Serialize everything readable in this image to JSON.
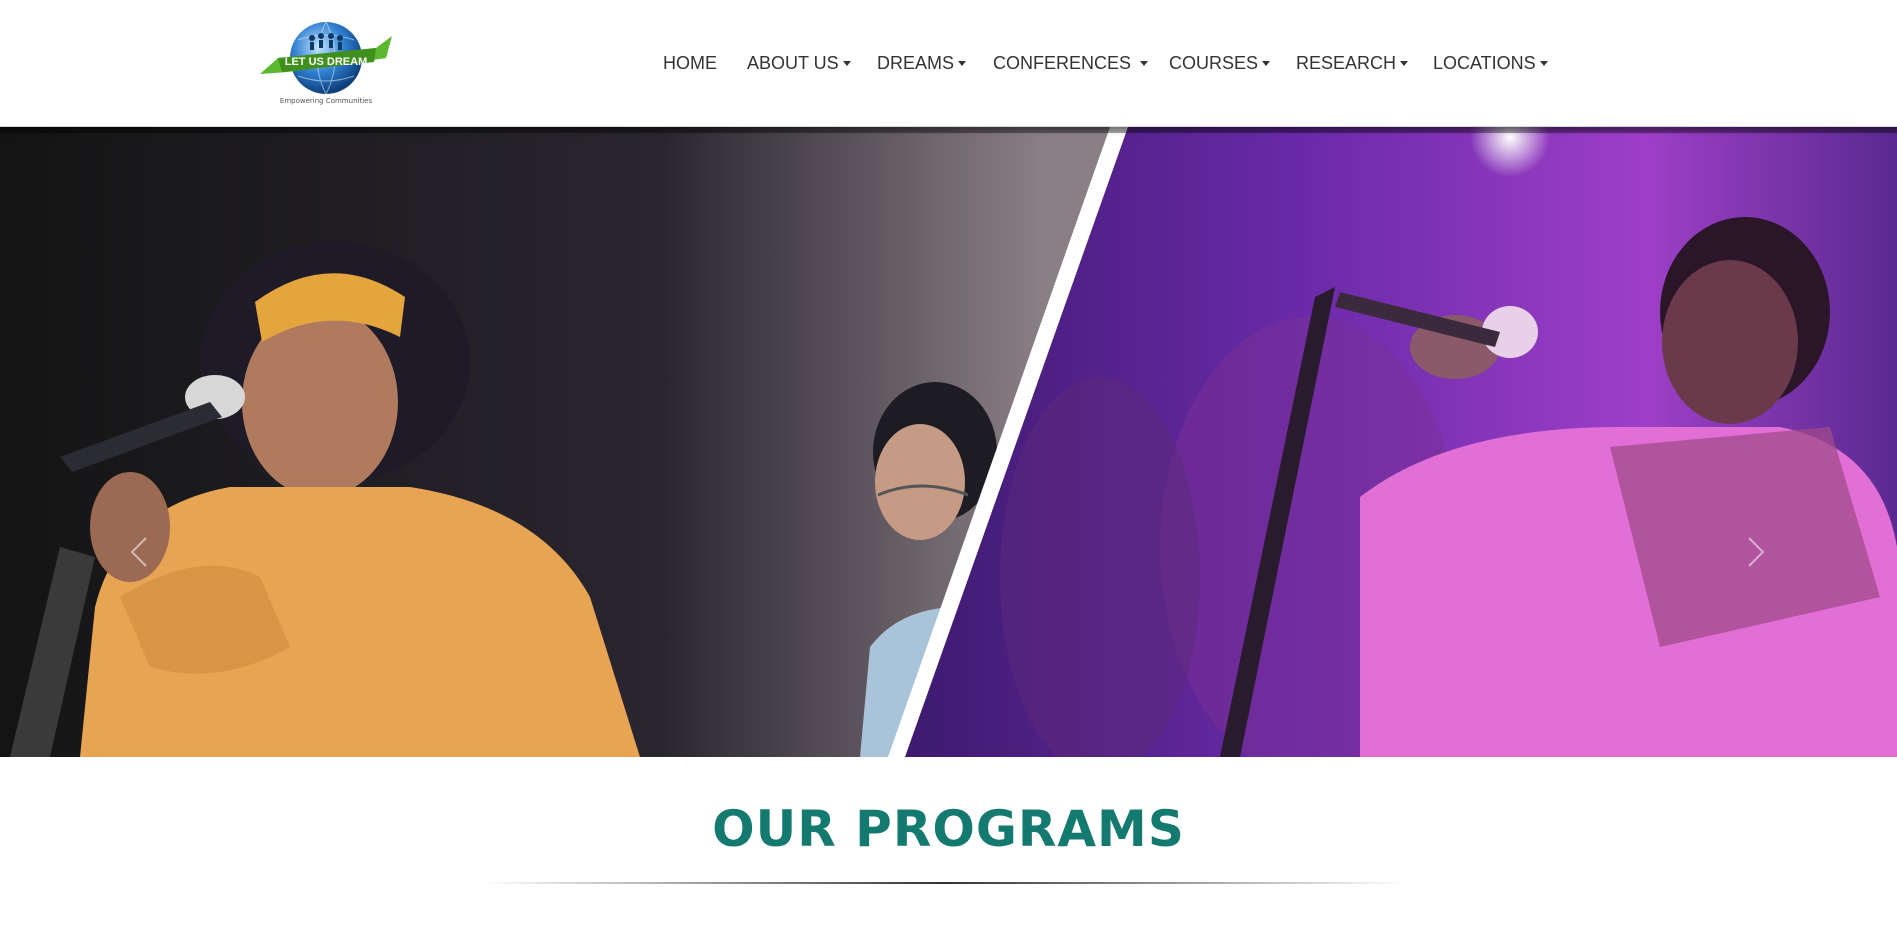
{
  "header": {
    "logo": {
      "text": "LET US DREAM",
      "tagline": "Empowering Communities",
      "colors": {
        "globe": "#2f7fd0",
        "ribbon": "#5cb82e"
      }
    },
    "nav": [
      {
        "label": "HOME",
        "dropdown": false
      },
      {
        "label": "ABOUT US",
        "dropdown": true
      },
      {
        "label": "DREAMS",
        "dropdown": true
      },
      {
        "label": "CONFERENCES",
        "dropdown": true
      },
      {
        "label": "COURSES",
        "dropdown": true
      },
      {
        "label": "RESEARCH",
        "dropdown": true
      },
      {
        "label": "LOCATIONS",
        "dropdown": true
      }
    ]
  },
  "hero": {
    "slide": "singers-performing-on-stage",
    "controls": {
      "prev_icon": "chevron-left-icon",
      "next_icon": "chevron-right-icon"
    }
  },
  "programs": {
    "title": "OUR PROGRAMS",
    "title_color": "#147a70"
  }
}
